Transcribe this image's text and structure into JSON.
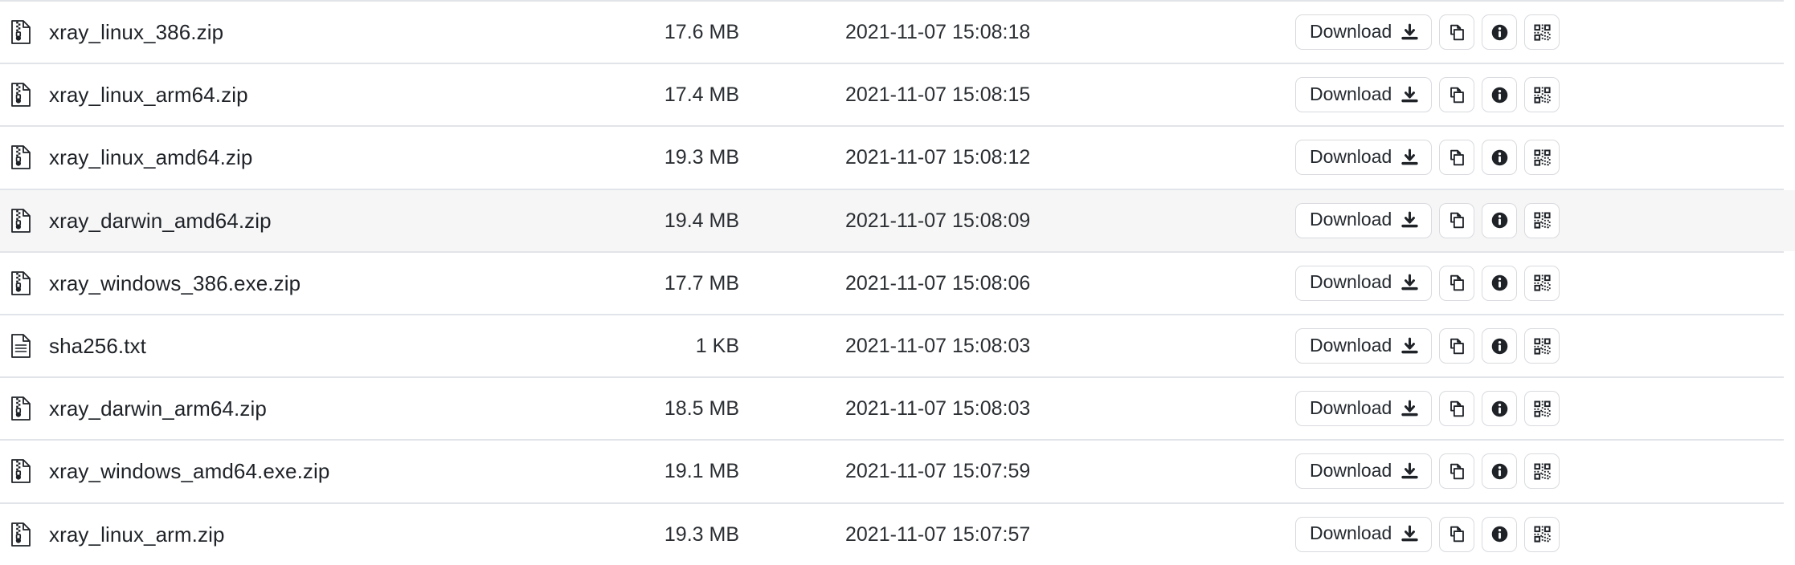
{
  "listing": {
    "columns": [
      "name",
      "size",
      "modified",
      "actions"
    ],
    "active_row_index": 3,
    "colors": {
      "row_border": "#e1e4e8",
      "row_hover_background": "#f6f6f6",
      "text": "#24292f",
      "button_border": "#d8dade",
      "background": "#ffffff"
    },
    "actions": {
      "download_label": "Download",
      "download_icon": "download-icon",
      "copy_icon": "copy-icon",
      "info_icon": "info-icon",
      "qrcode_icon": "qrcode-icon"
    },
    "rows": [
      {
        "icon": "zip-file-icon",
        "name": "xray_linux_386.zip",
        "size": "17.6 MB",
        "modified": "2021-11-07 15:08:18"
      },
      {
        "icon": "zip-file-icon",
        "name": "xray_linux_arm64.zip",
        "size": "17.4 MB",
        "modified": "2021-11-07 15:08:15"
      },
      {
        "icon": "zip-file-icon",
        "name": "xray_linux_amd64.zip",
        "size": "19.3 MB",
        "modified": "2021-11-07 15:08:12"
      },
      {
        "icon": "zip-file-icon",
        "name": "xray_darwin_amd64.zip",
        "size": "19.4 MB",
        "modified": "2021-11-07 15:08:09"
      },
      {
        "icon": "zip-file-icon",
        "name": "xray_windows_386.exe.zip",
        "size": "17.7 MB",
        "modified": "2021-11-07 15:08:06"
      },
      {
        "icon": "text-file-icon",
        "name": "sha256.txt",
        "size": "1 KB",
        "modified": "2021-11-07 15:08:03"
      },
      {
        "icon": "zip-file-icon",
        "name": "xray_darwin_arm64.zip",
        "size": "18.5 MB",
        "modified": "2021-11-07 15:08:03"
      },
      {
        "icon": "zip-file-icon",
        "name": "xray_windows_amd64.exe.zip",
        "size": "19.1 MB",
        "modified": "2021-11-07 15:07:59"
      },
      {
        "icon": "zip-file-icon",
        "name": "xray_linux_arm.zip",
        "size": "19.3 MB",
        "modified": "2021-11-07 15:07:57"
      }
    ]
  }
}
